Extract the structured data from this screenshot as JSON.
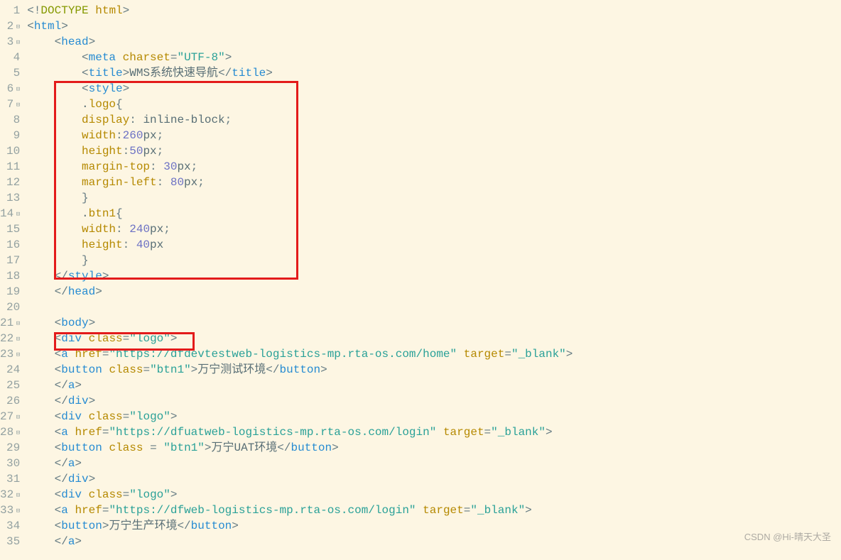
{
  "watermark": "CSDN @Hi-晴天大圣",
  "colors": {
    "bg": "#fdf6e3",
    "tag": "#268bd2",
    "attr": "#b58900",
    "string": "#2aa198",
    "number": "#6c71c4",
    "keyword": "#859900",
    "highlight": "#e31b1b"
  },
  "highlight_boxes": [
    {
      "lines": [
        6,
        18
      ]
    },
    {
      "lines": [
        22,
        22
      ]
    }
  ],
  "lines": [
    {
      "n": 1,
      "fold": false,
      "tokens": [
        [
          "punc",
          "<!"
        ],
        [
          "kw",
          "DOCTYPE"
        ],
        [
          "txt",
          " "
        ],
        [
          "attr",
          "html"
        ],
        [
          "punc",
          ">"
        ]
      ]
    },
    {
      "n": 2,
      "fold": true,
      "tokens": [
        [
          "punc",
          "<"
        ],
        [
          "tag",
          "html"
        ],
        [
          "punc",
          ">"
        ]
      ]
    },
    {
      "n": 3,
      "fold": true,
      "tokens": [
        [
          "txt",
          "    "
        ],
        [
          "punc",
          "<"
        ],
        [
          "tag",
          "head"
        ],
        [
          "punc",
          ">"
        ]
      ]
    },
    {
      "n": 4,
      "fold": false,
      "tokens": [
        [
          "txt",
          "        "
        ],
        [
          "punc",
          "<"
        ],
        [
          "tag",
          "meta"
        ],
        [
          "txt",
          " "
        ],
        [
          "attr",
          "charset"
        ],
        [
          "punc",
          "="
        ],
        [
          "str",
          "\"UTF-8\""
        ],
        [
          "punc",
          ">"
        ]
      ]
    },
    {
      "n": 5,
      "fold": false,
      "tokens": [
        [
          "txt",
          "        "
        ],
        [
          "punc",
          "<"
        ],
        [
          "tag",
          "title"
        ],
        [
          "punc",
          ">"
        ],
        [
          "txt",
          "WMS系统快速导航"
        ],
        [
          "punc",
          "</"
        ],
        [
          "tag",
          "title"
        ],
        [
          "punc",
          ">"
        ]
      ]
    },
    {
      "n": 6,
      "fold": true,
      "tokens": [
        [
          "txt",
          "        "
        ],
        [
          "punc",
          "<"
        ],
        [
          "tag",
          "style"
        ],
        [
          "punc",
          ">"
        ]
      ]
    },
    {
      "n": 7,
      "fold": true,
      "tokens": [
        [
          "txt",
          "        ."
        ],
        [
          "attr",
          "logo"
        ],
        [
          "punc",
          "{"
        ]
      ]
    },
    {
      "n": 8,
      "fold": false,
      "tokens": [
        [
          "txt",
          "        "
        ],
        [
          "attr",
          "display"
        ],
        [
          "punc",
          ": "
        ],
        [
          "txt",
          "inline-block"
        ],
        [
          "punc",
          ";"
        ]
      ]
    },
    {
      "n": 9,
      "fold": false,
      "tokens": [
        [
          "txt",
          "        "
        ],
        [
          "attr",
          "width"
        ],
        [
          "punc",
          ":"
        ],
        [
          "num",
          "260"
        ],
        [
          "txt",
          "px"
        ],
        [
          "punc",
          ";"
        ]
      ]
    },
    {
      "n": 10,
      "fold": false,
      "tokens": [
        [
          "txt",
          "        "
        ],
        [
          "attr",
          "height"
        ],
        [
          "punc",
          ":"
        ],
        [
          "num",
          "50"
        ],
        [
          "txt",
          "px"
        ],
        [
          "punc",
          ";"
        ]
      ]
    },
    {
      "n": 11,
      "fold": false,
      "tokens": [
        [
          "txt",
          "        "
        ],
        [
          "attr",
          "margin-top"
        ],
        [
          "punc",
          ": "
        ],
        [
          "num",
          "30"
        ],
        [
          "txt",
          "px"
        ],
        [
          "punc",
          ";"
        ]
      ]
    },
    {
      "n": 12,
      "fold": false,
      "tokens": [
        [
          "txt",
          "        "
        ],
        [
          "attr",
          "margin-left"
        ],
        [
          "punc",
          ": "
        ],
        [
          "num",
          "80"
        ],
        [
          "txt",
          "px"
        ],
        [
          "punc",
          ";"
        ]
      ]
    },
    {
      "n": 13,
      "fold": false,
      "tokens": [
        [
          "txt",
          "        "
        ],
        [
          "punc",
          "}"
        ]
      ]
    },
    {
      "n": 14,
      "fold": true,
      "tokens": [
        [
          "txt",
          "        ."
        ],
        [
          "attr",
          "btn1"
        ],
        [
          "punc",
          "{"
        ]
      ]
    },
    {
      "n": 15,
      "fold": false,
      "tokens": [
        [
          "txt",
          "        "
        ],
        [
          "attr",
          "width"
        ],
        [
          "punc",
          ": "
        ],
        [
          "num",
          "240"
        ],
        [
          "txt",
          "px"
        ],
        [
          "punc",
          ";"
        ]
      ]
    },
    {
      "n": 16,
      "fold": false,
      "tokens": [
        [
          "txt",
          "        "
        ],
        [
          "attr",
          "height"
        ],
        [
          "punc",
          ": "
        ],
        [
          "num",
          "40"
        ],
        [
          "txt",
          "px"
        ]
      ]
    },
    {
      "n": 17,
      "fold": false,
      "tokens": [
        [
          "txt",
          "        "
        ],
        [
          "punc",
          "}"
        ]
      ]
    },
    {
      "n": 18,
      "fold": false,
      "tokens": [
        [
          "txt",
          "    "
        ],
        [
          "punc",
          "</"
        ],
        [
          "tag",
          "style"
        ],
        [
          "punc",
          ">"
        ]
      ]
    },
    {
      "n": 19,
      "fold": false,
      "tokens": [
        [
          "txt",
          "    "
        ],
        [
          "punc",
          "</"
        ],
        [
          "tag",
          "head"
        ],
        [
          "punc",
          ">"
        ]
      ]
    },
    {
      "n": 20,
      "fold": false,
      "tokens": []
    },
    {
      "n": 21,
      "fold": true,
      "tokens": [
        [
          "txt",
          "    "
        ],
        [
          "punc",
          "<"
        ],
        [
          "tag",
          "body"
        ],
        [
          "punc",
          ">"
        ]
      ]
    },
    {
      "n": 22,
      "fold": true,
      "tokens": [
        [
          "txt",
          "    "
        ],
        [
          "punc",
          "<"
        ],
        [
          "tag",
          "div"
        ],
        [
          "txt",
          " "
        ],
        [
          "attr",
          "class"
        ],
        [
          "punc",
          "="
        ],
        [
          "str",
          "\"logo\""
        ],
        [
          "punc",
          ">"
        ]
      ]
    },
    {
      "n": 23,
      "fold": true,
      "tokens": [
        [
          "txt",
          "    "
        ],
        [
          "punc",
          "<"
        ],
        [
          "tag",
          "a"
        ],
        [
          "txt",
          " "
        ],
        [
          "attr",
          "href"
        ],
        [
          "punc",
          "="
        ],
        [
          "str",
          "\"https://dfdevtestweb-logistics-mp.rta-os.com/home\""
        ],
        [
          "txt",
          " "
        ],
        [
          "attr",
          "target"
        ],
        [
          "punc",
          "="
        ],
        [
          "str",
          "\"_blank\""
        ],
        [
          "punc",
          ">"
        ]
      ]
    },
    {
      "n": 24,
      "fold": false,
      "tokens": [
        [
          "txt",
          "    "
        ],
        [
          "punc",
          "<"
        ],
        [
          "tag",
          "button"
        ],
        [
          "txt",
          " "
        ],
        [
          "attr",
          "class"
        ],
        [
          "punc",
          "="
        ],
        [
          "str",
          "\"btn1\""
        ],
        [
          "punc",
          ">"
        ],
        [
          "txt",
          "万宁测试环境"
        ],
        [
          "punc",
          "</"
        ],
        [
          "tag",
          "button"
        ],
        [
          "punc",
          ">"
        ]
      ]
    },
    {
      "n": 25,
      "fold": false,
      "tokens": [
        [
          "txt",
          "    "
        ],
        [
          "punc",
          "</"
        ],
        [
          "tag",
          "a"
        ],
        [
          "punc",
          ">"
        ]
      ]
    },
    {
      "n": 26,
      "fold": false,
      "tokens": [
        [
          "txt",
          "    "
        ],
        [
          "punc",
          "</"
        ],
        [
          "tag",
          "div"
        ],
        [
          "punc",
          ">"
        ]
      ]
    },
    {
      "n": 27,
      "fold": true,
      "tokens": [
        [
          "txt",
          "    "
        ],
        [
          "punc",
          "<"
        ],
        [
          "tag",
          "div"
        ],
        [
          "txt",
          " "
        ],
        [
          "attr",
          "class"
        ],
        [
          "punc",
          "="
        ],
        [
          "str",
          "\"logo\""
        ],
        [
          "punc",
          ">"
        ]
      ]
    },
    {
      "n": 28,
      "fold": true,
      "tokens": [
        [
          "txt",
          "    "
        ],
        [
          "punc",
          "<"
        ],
        [
          "tag",
          "a"
        ],
        [
          "txt",
          " "
        ],
        [
          "attr",
          "href"
        ],
        [
          "punc",
          "="
        ],
        [
          "str",
          "\"https://dfuatweb-logistics-mp.rta-os.com/login\""
        ],
        [
          "txt",
          " "
        ],
        [
          "attr",
          "target"
        ],
        [
          "punc",
          "="
        ],
        [
          "str",
          "\"_blank\""
        ],
        [
          "punc",
          ">"
        ]
      ]
    },
    {
      "n": 29,
      "fold": false,
      "tokens": [
        [
          "txt",
          "    "
        ],
        [
          "punc",
          "<"
        ],
        [
          "tag",
          "button"
        ],
        [
          "txt",
          " "
        ],
        [
          "attr",
          "class"
        ],
        [
          "txt",
          " "
        ],
        [
          "punc",
          "= "
        ],
        [
          "str",
          "\"btn1\""
        ],
        [
          "punc",
          ">"
        ],
        [
          "txt",
          "万宁UAT环境"
        ],
        [
          "punc",
          "</"
        ],
        [
          "tag",
          "button"
        ],
        [
          "punc",
          ">"
        ]
      ]
    },
    {
      "n": 30,
      "fold": false,
      "tokens": [
        [
          "txt",
          "    "
        ],
        [
          "punc",
          "</"
        ],
        [
          "tag",
          "a"
        ],
        [
          "punc",
          ">"
        ]
      ]
    },
    {
      "n": 31,
      "fold": false,
      "tokens": [
        [
          "txt",
          "    "
        ],
        [
          "punc",
          "</"
        ],
        [
          "tag",
          "div"
        ],
        [
          "punc",
          ">"
        ]
      ]
    },
    {
      "n": 32,
      "fold": true,
      "tokens": [
        [
          "txt",
          "    "
        ],
        [
          "punc",
          "<"
        ],
        [
          "tag",
          "div"
        ],
        [
          "txt",
          " "
        ],
        [
          "attr",
          "class"
        ],
        [
          "punc",
          "="
        ],
        [
          "str",
          "\"logo\""
        ],
        [
          "punc",
          ">"
        ]
      ]
    },
    {
      "n": 33,
      "fold": true,
      "tokens": [
        [
          "txt",
          "    "
        ],
        [
          "punc",
          "<"
        ],
        [
          "tag",
          "a"
        ],
        [
          "txt",
          " "
        ],
        [
          "attr",
          "href"
        ],
        [
          "punc",
          "="
        ],
        [
          "str",
          "\"https://dfweb-logistics-mp.rta-os.com/login\""
        ],
        [
          "txt",
          " "
        ],
        [
          "attr",
          "target"
        ],
        [
          "punc",
          "="
        ],
        [
          "str",
          "\"_blank\""
        ],
        [
          "punc",
          ">"
        ]
      ]
    },
    {
      "n": 34,
      "fold": false,
      "tokens": [
        [
          "txt",
          "    "
        ],
        [
          "punc",
          "<"
        ],
        [
          "tag",
          "button"
        ],
        [
          "punc",
          ">"
        ],
        [
          "txt",
          "万宁生产环境"
        ],
        [
          "punc",
          "</"
        ],
        [
          "tag",
          "button"
        ],
        [
          "punc",
          ">"
        ]
      ]
    },
    {
      "n": 35,
      "fold": false,
      "tokens": [
        [
          "txt",
          "    "
        ],
        [
          "punc",
          "</"
        ],
        [
          "tag",
          "a"
        ],
        [
          "punc",
          ">"
        ]
      ]
    }
  ]
}
